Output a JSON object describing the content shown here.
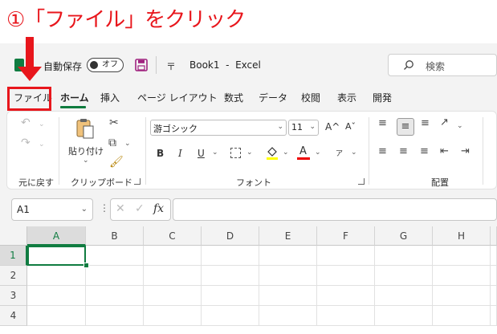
{
  "annotation": {
    "caption": "①「ファイル」をクリック"
  },
  "titlebar": {
    "autosave_label": "自動保存",
    "autosave_toggle": "オフ",
    "separator_glyph": "〒",
    "book_title": "Book1  -  Excel",
    "search_placeholder": "検索"
  },
  "ribbon_tabs": [
    {
      "label": "ファイル"
    },
    {
      "label": "ホーム",
      "active": true
    },
    {
      "label": "挿入"
    },
    {
      "label": "ページ レイアウト"
    },
    {
      "label": "数式"
    },
    {
      "label": "データ"
    },
    {
      "label": "校閲"
    },
    {
      "label": "表示"
    },
    {
      "label": "開発"
    }
  ],
  "ribbon": {
    "undo_group": {
      "label": "元に戻す"
    },
    "clipboard_group": {
      "label": "クリップボード",
      "paste_label": "貼り付け"
    },
    "font_group": {
      "label": "フォント",
      "font_name": "游ゴシック",
      "font_size": "11",
      "bold": "B",
      "italic": "I",
      "underline": "U",
      "grow_font": "A^",
      "shrink_font": "Aˇ",
      "font_color_letter": "A",
      "phonetic_glyph": "ア"
    },
    "alignment_group": {
      "label": "配置"
    }
  },
  "formula_bar": {
    "name_box": "A1",
    "fx_label": "fx",
    "formula": ""
  },
  "sheet": {
    "columns": [
      "A",
      "B",
      "C",
      "D",
      "E",
      "F",
      "G",
      "H"
    ],
    "rows": [
      "1",
      "2",
      "3",
      "4"
    ],
    "selected_cell": "A1"
  },
  "colors": {
    "annotation_red": "#e8161c",
    "excel_green": "#107c41",
    "save_icon": "#a0227f"
  },
  "icons": [
    "excel-logo-icon",
    "save-icon",
    "search-icon",
    "undo-icon",
    "redo-icon",
    "paste-icon",
    "cut-icon",
    "copy-icon",
    "format-painter-icon",
    "border-icon",
    "fill-color-icon",
    "font-color-icon",
    "align-icon",
    "dialog-launcher-icon",
    "cancel-icon",
    "enter-icon"
  ]
}
